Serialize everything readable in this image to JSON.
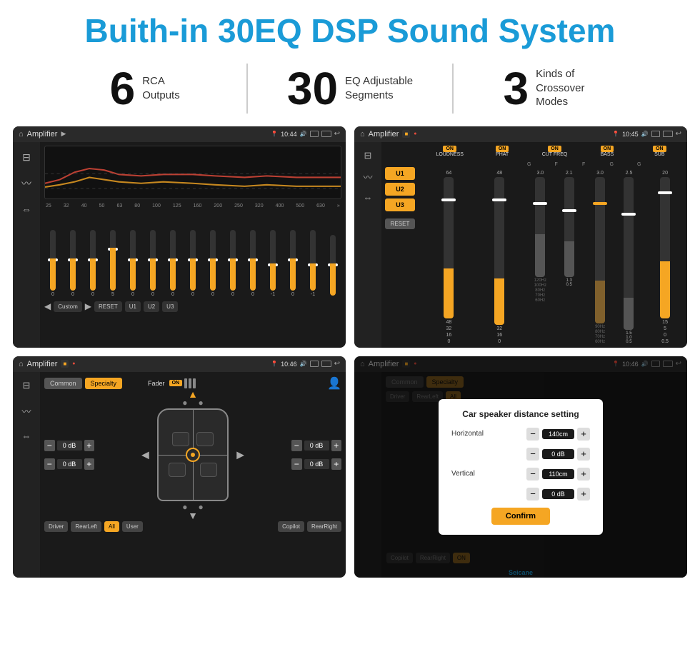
{
  "header": {
    "title": "Buith-in 30EQ DSP Sound System"
  },
  "stats": [
    {
      "number": "6",
      "text": "RCA\nOutputs"
    },
    {
      "number": "30",
      "text": "EQ Adjustable\nSegments"
    },
    {
      "number": "3",
      "text": "Kinds of\nCrossover Modes"
    }
  ],
  "screens": [
    {
      "id": "eq-screen",
      "title": "Amplifier",
      "time": "10:44",
      "type": "eq"
    },
    {
      "id": "crossover-screen",
      "title": "Amplifier",
      "time": "10:45",
      "type": "crossover"
    },
    {
      "id": "fader-screen",
      "title": "Amplifier",
      "time": "10:46",
      "type": "fader"
    },
    {
      "id": "dialog-screen",
      "title": "Amplifier",
      "time": "10:46",
      "type": "dialog"
    }
  ],
  "eq": {
    "freqs": [
      "25",
      "32",
      "40",
      "50",
      "63",
      "80",
      "100",
      "125",
      "160",
      "200",
      "250",
      "320",
      "400",
      "500",
      "630"
    ],
    "values": [
      "0",
      "0",
      "0",
      "5",
      "0",
      "0",
      "0",
      "0",
      "0",
      "0",
      "0",
      "-1",
      "0",
      "-1",
      ""
    ],
    "presets": [
      "RESET",
      "U1",
      "U2",
      "U3"
    ],
    "custom": "Custom"
  },
  "crossover": {
    "presets": [
      "U1",
      "U2",
      "U3"
    ],
    "channels": [
      "LOUDNESS",
      "PHAT",
      "CUT FREQ",
      "BASS",
      "SUB"
    ],
    "reset": "RESET"
  },
  "fader": {
    "tabs": [
      "Common",
      "Specialty"
    ],
    "fader_label": "Fader",
    "on_label": "ON",
    "db_values": [
      "0 dB",
      "0 dB",
      "0 dB",
      "0 dB"
    ],
    "buttons": [
      "Driver",
      "RearLeft",
      "All",
      "User",
      "Copilot",
      "RearRight"
    ]
  },
  "dialog": {
    "title": "Car speaker distance setting",
    "horizontal_label": "Horizontal",
    "horizontal_value": "140cm",
    "vertical_label": "Vertical",
    "vertical_value": "110cm",
    "confirm_label": "Confirm",
    "db_values": [
      "0 dB",
      "0 dB"
    ]
  },
  "watermark": "Seicane"
}
